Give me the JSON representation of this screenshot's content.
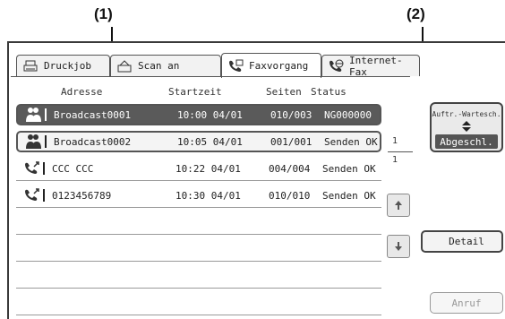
{
  "callouts": {
    "one": "(1)",
    "two": "(2)"
  },
  "tabs": [
    {
      "label": "Druckjob",
      "icon": "printer-icon"
    },
    {
      "label": "Scan an",
      "icon": "scanner-icon"
    },
    {
      "label": "Faxvorgang",
      "icon": "fax-phone-icon"
    },
    {
      "label": "Internet-Fax",
      "icon": "internet-fax-icon"
    }
  ],
  "columns": {
    "address": "Adresse",
    "start": "Startzeit",
    "pages": "Seiten",
    "status": "Status"
  },
  "rows": [
    {
      "address": "Broadcast0001",
      "time": "10:00 04/01",
      "pages": "010/003",
      "status": "NG000000",
      "icon": "broadcast-icon"
    },
    {
      "address": "Broadcast0002",
      "time": "10:05 04/01",
      "pages": "001/001",
      "status": "Senden OK",
      "icon": "broadcast-icon"
    },
    {
      "address": "CCC CCC",
      "time": "10:22 04/01",
      "pages": "004/004",
      "status": "Senden OK",
      "icon": "fax-send-icon"
    },
    {
      "address": "0123456789",
      "time": "10:30 04/01",
      "pages": "010/010",
      "status": "Senden OK",
      "icon": "fax-send-icon"
    }
  ],
  "pager": {
    "current": "1",
    "total": "1"
  },
  "queue_toggle": {
    "top_label": "Auftr.-Wartesch.",
    "bottom_label": "Abgeschl."
  },
  "buttons": {
    "detail": "Detail",
    "anruf": "Anruf"
  }
}
